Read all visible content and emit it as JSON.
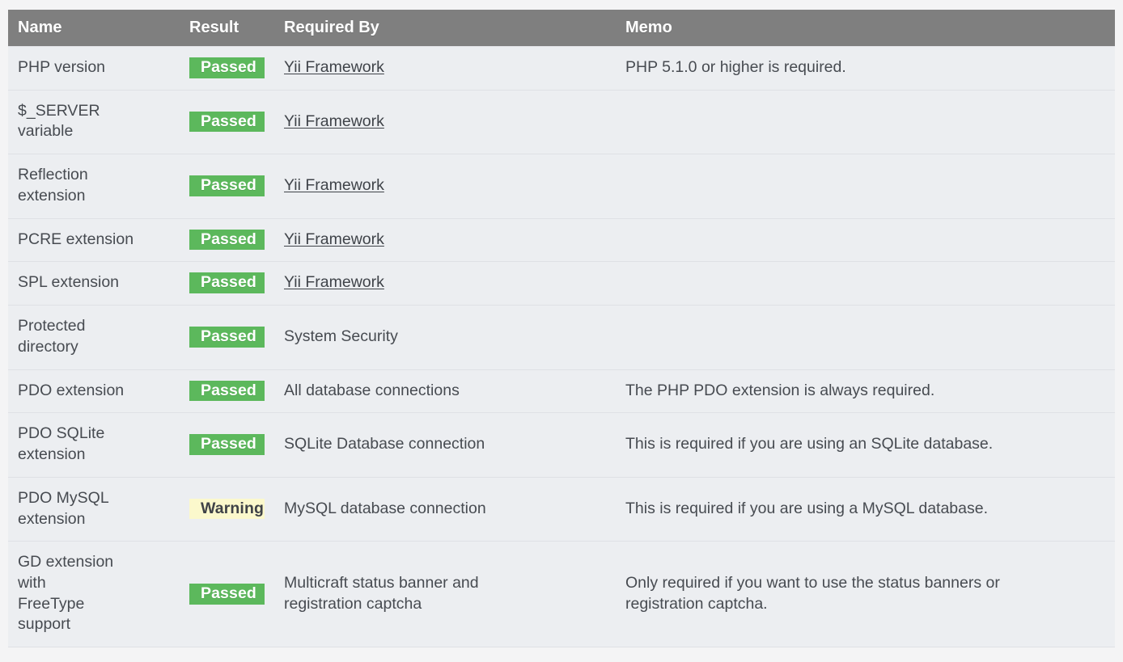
{
  "table": {
    "columns": [
      "Name",
      "Result",
      "Required By",
      "Memo"
    ],
    "rows": [
      {
        "name": "PHP version",
        "result": "Passed",
        "result_state": "passed",
        "required_by": "Yii Framework",
        "required_by_is_link": true,
        "memo": "PHP 5.1.0 or higher is required."
      },
      {
        "name": "$_SERVER variable",
        "result": "Passed",
        "result_state": "passed",
        "required_by": "Yii Framework",
        "required_by_is_link": true,
        "memo": ""
      },
      {
        "name": "Reflection extension",
        "result": "Passed",
        "result_state": "passed",
        "required_by": "Yii Framework",
        "required_by_is_link": true,
        "memo": ""
      },
      {
        "name": "PCRE extension",
        "result": "Passed",
        "result_state": "passed",
        "required_by": "Yii Framework",
        "required_by_is_link": true,
        "memo": ""
      },
      {
        "name": "SPL extension",
        "result": "Passed",
        "result_state": "passed",
        "required_by": "Yii Framework",
        "required_by_is_link": true,
        "memo": ""
      },
      {
        "name": "Protected directory",
        "result": "Passed",
        "result_state": "passed",
        "required_by": "System Security",
        "required_by_is_link": false,
        "memo": ""
      },
      {
        "name": "PDO extension",
        "result": "Passed",
        "result_state": "passed",
        "required_by": "All database connections",
        "required_by_is_link": false,
        "memo": "The PHP PDO extension is always required."
      },
      {
        "name": "PDO SQLite extension",
        "result": "Passed",
        "result_state": "passed",
        "required_by": "SQLite Database connection",
        "required_by_is_link": false,
        "memo": "This is required if you are using an SQLite database."
      },
      {
        "name": "PDO MySQL extension",
        "result": "Warning",
        "result_state": "warning",
        "required_by": "MySQL database connection",
        "required_by_is_link": false,
        "memo": "This is required if you are using a MySQL database."
      },
      {
        "name": "GD extension with FreeType support",
        "result": "Passed",
        "result_state": "passed",
        "required_by": "Multicraft status banner and registration captcha",
        "required_by_is_link": false,
        "memo": "Only required if you want to use the status banners or registration captcha."
      }
    ]
  },
  "colors": {
    "header_background": "#7f7f7f",
    "header_text": "#ffffff",
    "row_background": "#eceef1",
    "row_divider": "#dfe1e5",
    "passed": "#5cb85c",
    "passed_text": "#ffffff",
    "warning": "#fbf8cc",
    "warning_text": "#3f4247",
    "page_background": "#f4f4f5",
    "body_text": "#474b51"
  },
  "row_name_lines": [
    [
      "PHP version"
    ],
    [
      "$_SERVER",
      "variable"
    ],
    [
      "Reflection",
      "extension"
    ],
    [
      "PCRE extension"
    ],
    [
      "SPL extension"
    ],
    [
      "Protected",
      "directory"
    ],
    [
      "PDO extension"
    ],
    [
      "PDO SQLite",
      "extension"
    ],
    [
      "PDO MySQL",
      "extension"
    ],
    [
      "GD extension",
      "with",
      "FreeType",
      "support"
    ]
  ],
  "row_required_lines": [
    [
      "Yii Framework"
    ],
    [
      "Yii Framework"
    ],
    [
      "Yii Framework"
    ],
    [
      "Yii Framework"
    ],
    [
      "Yii Framework"
    ],
    [
      "System Security"
    ],
    [
      "All database connections"
    ],
    [
      "SQLite Database connection"
    ],
    [
      "MySQL database connection"
    ],
    [
      "Multicraft status banner and",
      "registration captcha"
    ]
  ],
  "row_memo_lines": [
    [
      "PHP 5.1.0 or higher is required."
    ],
    [
      ""
    ],
    [
      ""
    ],
    [
      ""
    ],
    [
      ""
    ],
    [
      ""
    ],
    [
      "The PHP PDO extension is always required."
    ],
    [
      "This is required if you are using an SQLite database."
    ],
    [
      "This is required if you are using a MySQL database."
    ],
    [
      "Only required if you want to use the status banners or",
      "registration captcha."
    ]
  ]
}
